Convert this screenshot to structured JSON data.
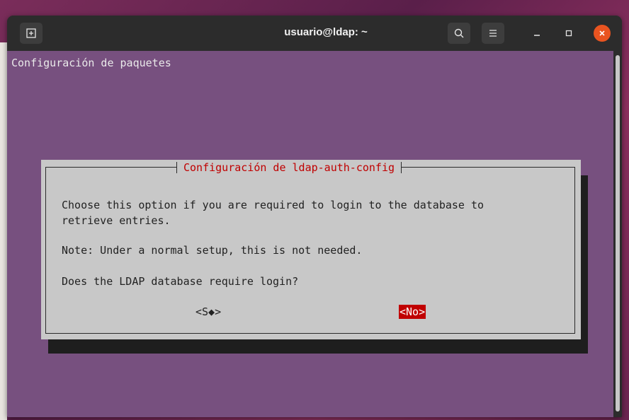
{
  "window": {
    "title": "usuario@ldap: ~",
    "close_color": "#e95420"
  },
  "icons": {
    "new_tab": "new-tab-icon",
    "search": "search-icon",
    "menu": "hamburger-menu-icon",
    "minimize": "minimize-icon",
    "maximize": "maximize-icon",
    "close": "close-icon"
  },
  "terminal": {
    "heading": "Configuración de paquetes",
    "background": "#77507f"
  },
  "dialog": {
    "title": "Configuración de ldap-auth-config",
    "text_lines": [
      "Choose this option if you are required to login to the database to\nretrieve entries.",
      "Note: Under a normal setup, this is not needed.",
      "Does the LDAP database require login?"
    ],
    "yes_button": "<S◆>",
    "no_button": "<No>",
    "selected_button": "No",
    "accent_color": "#c00000"
  }
}
